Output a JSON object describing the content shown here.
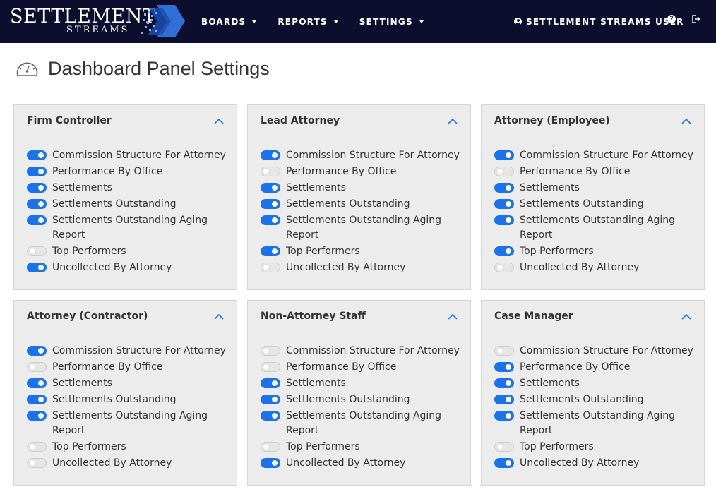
{
  "brand": {
    "line1": "SETTLEMENT",
    "line2": "STREAMS"
  },
  "nav": {
    "items": [
      {
        "label": "BOARDS"
      },
      {
        "label": "REPORTS"
      },
      {
        "label": "SETTINGS"
      }
    ],
    "user_label": "SETTLEMENT STREAMS USER",
    "help_glyph": "?"
  },
  "page": {
    "title": "Dashboard Panel Settings"
  },
  "colors": {
    "navbar": "#0d0d2e",
    "toggle_on": "#1a73e8",
    "panel_bg": "#ececec"
  },
  "icons": {
    "page": "gauge-icon",
    "user": "user-icon",
    "help": "help-icon",
    "logout": "logout-icon",
    "collapse": "chevron-up-icon"
  },
  "panels": [
    {
      "title": "Firm Controller",
      "toggles": [
        {
          "label": "Commission Structure For Attorney",
          "on": true
        },
        {
          "label": "Performance By Office",
          "on": true
        },
        {
          "label": "Settlements",
          "on": true
        },
        {
          "label": "Settlements Outstanding",
          "on": true
        },
        {
          "label": "Settlements Outstanding Aging Report",
          "on": true
        },
        {
          "label": "Top Performers",
          "on": false
        },
        {
          "label": "Uncollected By Attorney",
          "on": true
        }
      ]
    },
    {
      "title": "Lead Attorney",
      "toggles": [
        {
          "label": "Commission Structure For Attorney",
          "on": true
        },
        {
          "label": "Performance By Office",
          "on": false
        },
        {
          "label": "Settlements",
          "on": true
        },
        {
          "label": "Settlements Outstanding",
          "on": true
        },
        {
          "label": "Settlements Outstanding Aging Report",
          "on": true
        },
        {
          "label": "Top Performers",
          "on": true
        },
        {
          "label": "Uncollected By Attorney",
          "on": false
        }
      ]
    },
    {
      "title": "Attorney (Employee)",
      "toggles": [
        {
          "label": "Commission Structure For Attorney",
          "on": true
        },
        {
          "label": "Performance By Office",
          "on": false
        },
        {
          "label": "Settlements",
          "on": true
        },
        {
          "label": "Settlements Outstanding",
          "on": true
        },
        {
          "label": "Settlements Outstanding Aging Report",
          "on": true
        },
        {
          "label": "Top Performers",
          "on": true
        },
        {
          "label": "Uncollected By Attorney",
          "on": false
        }
      ]
    },
    {
      "title": "Attorney (Contractor)",
      "toggles": [
        {
          "label": "Commission Structure For Attorney",
          "on": true
        },
        {
          "label": "Performance By Office",
          "on": false
        },
        {
          "label": "Settlements",
          "on": true
        },
        {
          "label": "Settlements Outstanding",
          "on": true
        },
        {
          "label": "Settlements Outstanding Aging Report",
          "on": true
        },
        {
          "label": "Top Performers",
          "on": false
        },
        {
          "label": "Uncollected By Attorney",
          "on": false
        }
      ]
    },
    {
      "title": "Non-Attorney Staff",
      "toggles": [
        {
          "label": "Commission Structure For Attorney",
          "on": false
        },
        {
          "label": "Performance By Office",
          "on": false
        },
        {
          "label": "Settlements",
          "on": true
        },
        {
          "label": "Settlements Outstanding",
          "on": true
        },
        {
          "label": "Settlements Outstanding Aging Report",
          "on": true
        },
        {
          "label": "Top Performers",
          "on": false
        },
        {
          "label": "Uncollected By Attorney",
          "on": true
        }
      ]
    },
    {
      "title": "Case Manager",
      "toggles": [
        {
          "label": "Commission Structure For Attorney",
          "on": false
        },
        {
          "label": "Performance By Office",
          "on": true
        },
        {
          "label": "Settlements",
          "on": true
        },
        {
          "label": "Settlements Outstanding",
          "on": true
        },
        {
          "label": "Settlements Outstanding Aging Report",
          "on": true
        },
        {
          "label": "Top Performers",
          "on": false
        },
        {
          "label": "Uncollected By Attorney",
          "on": true
        }
      ]
    }
  ]
}
